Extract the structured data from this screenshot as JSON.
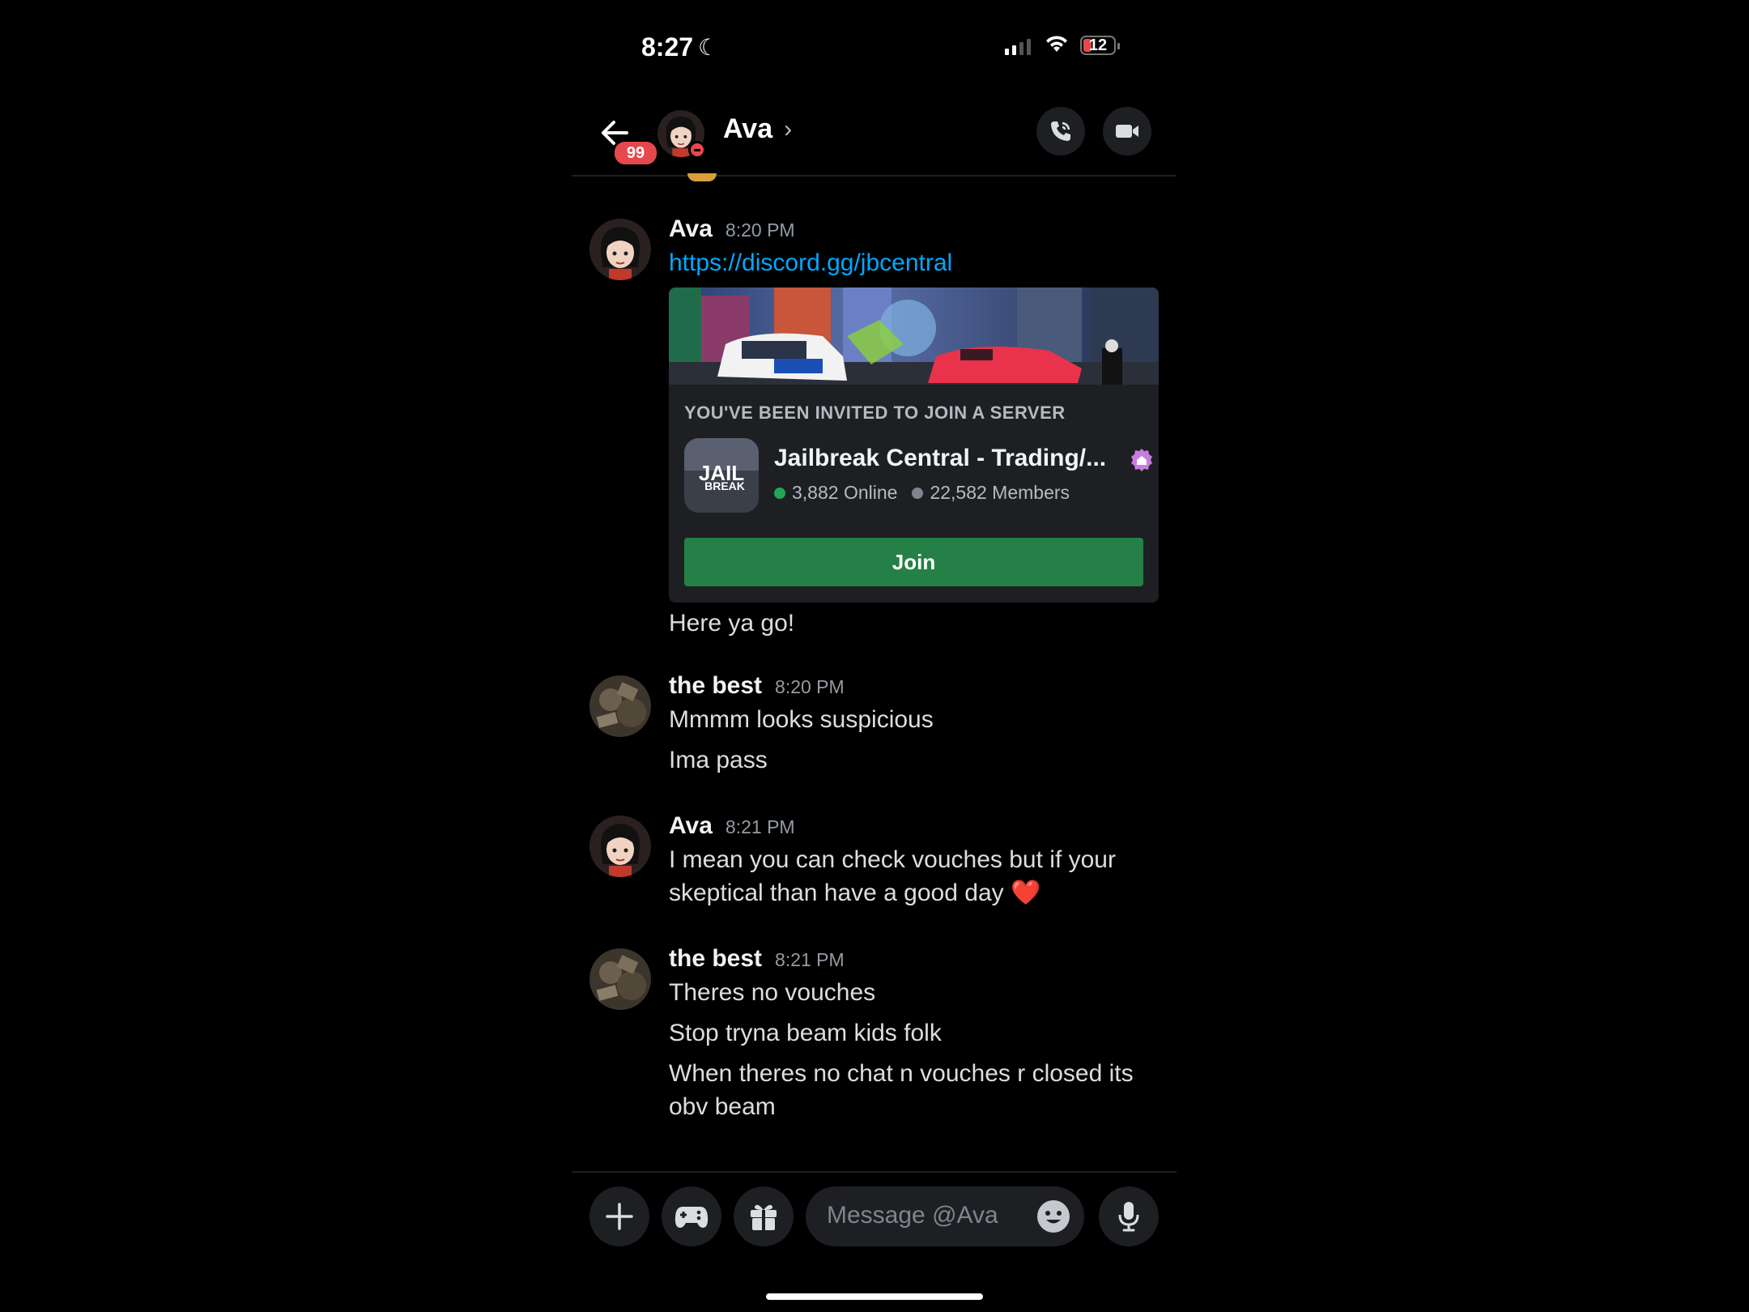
{
  "status_bar": {
    "time": "8:27",
    "battery": "12"
  },
  "header": {
    "unread_badge": "99",
    "title": "Ava",
    "chevron": "›"
  },
  "messages": [
    {
      "author": "Ava",
      "time": "8:20 PM",
      "link": "https://discord.gg/jbcentral",
      "invite": {
        "heading": "YOU'VE BEEN INVITED TO JOIN A SERVER",
        "server_name": "Jailbreak Central - Trading/...",
        "icon_text_top": "JAIL",
        "icon_text_bottom": "BREAK",
        "online": "3,882 Online",
        "members": "22,582 Members",
        "join_label": "Join"
      },
      "lines": [
        "Here ya go!"
      ]
    },
    {
      "author": "the best",
      "time": "8:20 PM",
      "lines": [
        "Mmmm looks suspicious",
        "Ima pass"
      ]
    },
    {
      "author": "Ava",
      "time": "8:21 PM",
      "lines": [
        "I mean you can check vouches but if your skeptical than have a good day ❤️"
      ]
    },
    {
      "author": "the best",
      "time": "8:21 PM",
      "lines": [
        "Theres no vouches",
        "Stop tryna beam kids folk",
        "When theres no chat n vouches r closed its obv beam"
      ]
    }
  ],
  "composer": {
    "placeholder": "Message @Ava"
  },
  "colors": {
    "background": "#000000",
    "link": "#00a8fc",
    "join": "#248046",
    "badge": "#e5484d",
    "online": "#23a55a"
  },
  "icons": [
    "back-arrow-icon",
    "phone-call-icon",
    "video-camera-icon",
    "plus-icon",
    "gamepad-icon",
    "gift-icon",
    "emoji-icon",
    "microphone-icon",
    "server-boost-icon"
  ]
}
